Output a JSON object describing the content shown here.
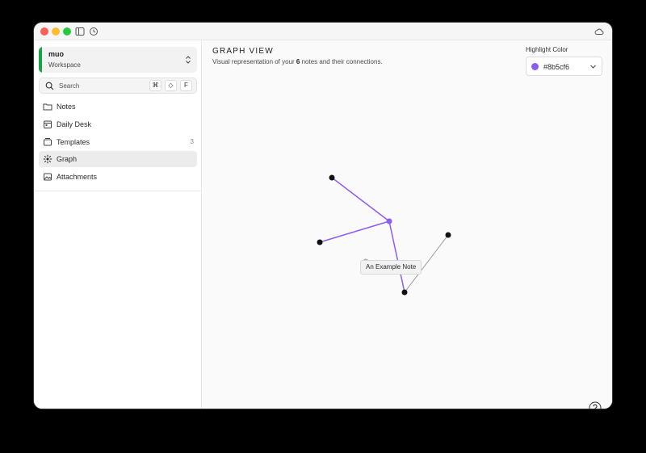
{
  "workspace": {
    "name": "muo",
    "subtitle": "Workspace",
    "accent": "#16a34a"
  },
  "search": {
    "placeholder": "Search",
    "shortcut_keys": [
      "⌘",
      "◇",
      "F"
    ]
  },
  "nav": [
    {
      "label": "Notes",
      "icon": "folder-icon",
      "count": ""
    },
    {
      "label": "Daily Desk",
      "icon": "calendar-icon",
      "count": ""
    },
    {
      "label": "Templates",
      "icon": "template-icon",
      "count": "3"
    },
    {
      "label": "Graph",
      "icon": "graph-icon",
      "count": "",
      "active": true
    },
    {
      "label": "Attachments",
      "icon": "image-icon",
      "count": ""
    }
  ],
  "main": {
    "title": "GRAPH VIEW",
    "subtitle_prefix": "Visual representation of your ",
    "note_count": "6",
    "subtitle_suffix": " notes and their connections."
  },
  "highlight": {
    "label": "Highlight Color",
    "value": "#8b5cf6"
  },
  "graph": {
    "highlight_color": "#8b5cf6",
    "tooltip": "An Example Note"
  },
  "icons": {
    "titlebar": [
      "sidebar-toggle-icon",
      "history-icon",
      "cloud-icon"
    ],
    "help": "help-icon"
  }
}
